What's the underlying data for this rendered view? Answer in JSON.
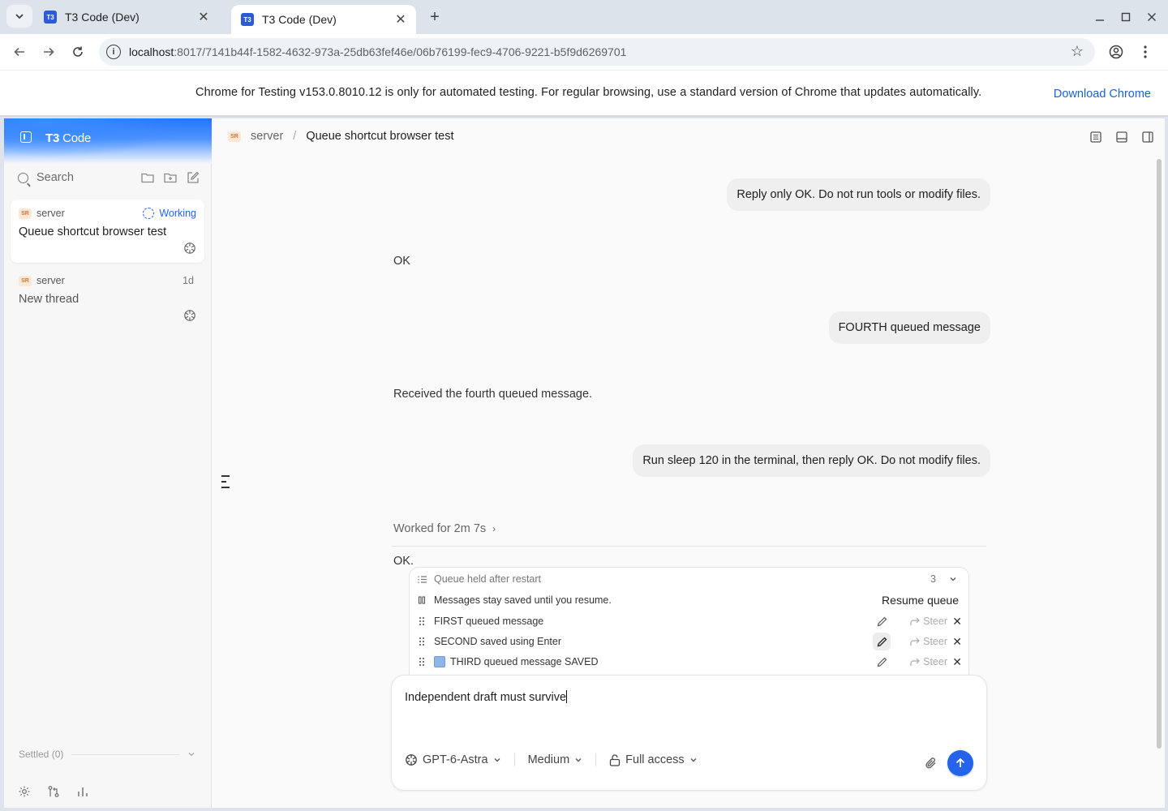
{
  "browser": {
    "tabs": [
      {
        "title": "T3 Code (Dev)",
        "favicon": "T3",
        "active": false
      },
      {
        "title": "T3 Code (Dev)",
        "favicon": "T3",
        "active": true
      }
    ],
    "url_host": "localhost",
    "url_path": ":8017/7141b44f-1582-4632-973a-25db63fef46e/06b76199-fec9-4706-9221-b5f9d6269701",
    "infobar_text": "Chrome for Testing v153.0.8010.12 is only for automated testing. For regular browsing, use a standard version of Chrome that updates automatically.",
    "infobar_link": "Download Chrome"
  },
  "sidebar": {
    "brand_bold": "T3",
    "brand_light": " Code",
    "search_label": "Search",
    "threads": [
      {
        "project_badge": "SR",
        "project": "server",
        "title": "Queue shortcut browser test",
        "status": "Working",
        "active": true
      },
      {
        "project_badge": "SR",
        "project": "server",
        "title": "New thread",
        "age": "1d",
        "active": false
      }
    ],
    "settled_label": "Settled (0)"
  },
  "header": {
    "project_badge": "SR",
    "project": "server",
    "separator": "/",
    "title": "Queue shortcut browser test"
  },
  "conversation": {
    "messages": [
      {
        "role": "user",
        "text": "Reply only OK. Do not run tools or modify files."
      },
      {
        "role": "assistant",
        "text": "OK"
      },
      {
        "role": "user",
        "text": "FOURTH queued message"
      },
      {
        "role": "assistant",
        "text": "Received the fourth queued message."
      },
      {
        "role": "user",
        "text": "Run sleep 120 in the terminal, then reply OK. Do not modify files."
      }
    ],
    "worked_label": "Worked for 2m 7s",
    "final_reply": "OK."
  },
  "queue": {
    "title": "Queue held after restart",
    "count": "3",
    "notice": "Messages stay saved until you resume.",
    "resume_label": "Resume queue",
    "steer_label": "Steer",
    "items": [
      {
        "text": "FIRST queued message",
        "has_image": false
      },
      {
        "text": "SECOND saved using Enter",
        "has_image": false
      },
      {
        "text": "THIRD queued message SAVED",
        "has_image": true
      }
    ]
  },
  "composer": {
    "draft": "Independent draft must survive",
    "model": "GPT-6-Astra",
    "effort": "Medium",
    "access": "Full access"
  },
  "colors": {
    "accent": "#2563eb",
    "badge_bg": "#fde8d8",
    "badge_fg": "#e0732a"
  }
}
